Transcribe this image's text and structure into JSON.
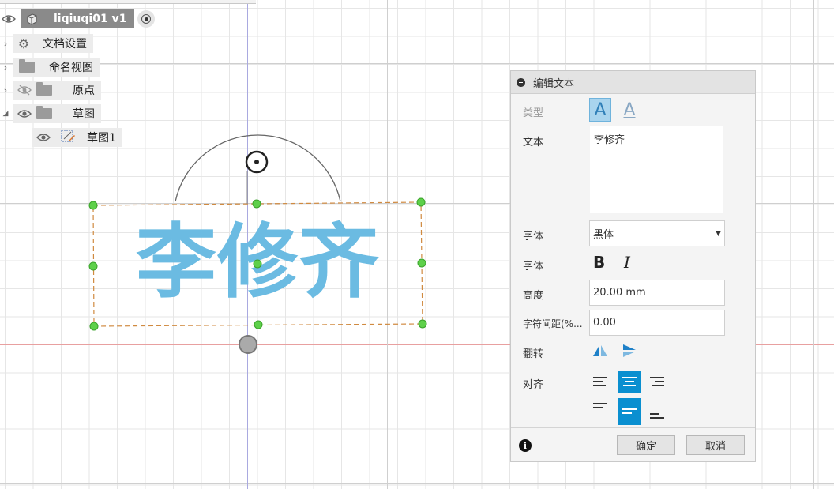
{
  "browser": {
    "root": {
      "label": "liqiuqi01 v1"
    },
    "items": [
      {
        "label": "文档设置",
        "icon": "gear-icon"
      },
      {
        "label": "命名视图",
        "icon": "folder-icon"
      },
      {
        "label": "原点",
        "icon": "folder-icon",
        "hidden": true
      },
      {
        "label": "草图",
        "icon": "folder-icon"
      },
      {
        "label": "草图1",
        "icon": "sketch-icon"
      }
    ]
  },
  "canvas": {
    "sketch_text": "李修齐",
    "text_color": "#6bbbe2"
  },
  "dialog": {
    "title": "编辑文本",
    "type_label": "类型",
    "text_label": "文本",
    "text_value": "李修齐",
    "font_label": "字体",
    "font_value": "黑体",
    "style_label": "字体",
    "bold_glyph": "B",
    "italic_glyph": "I",
    "height_label": "高度",
    "height_value": "20.00 mm",
    "spacing_label": "字符间距(%...",
    "spacing_value": "0.00",
    "flip_label": "翻转",
    "align_label": "对齐",
    "ok_label": "确定",
    "cancel_label": "取消",
    "accent": "#0a8fd0"
  }
}
